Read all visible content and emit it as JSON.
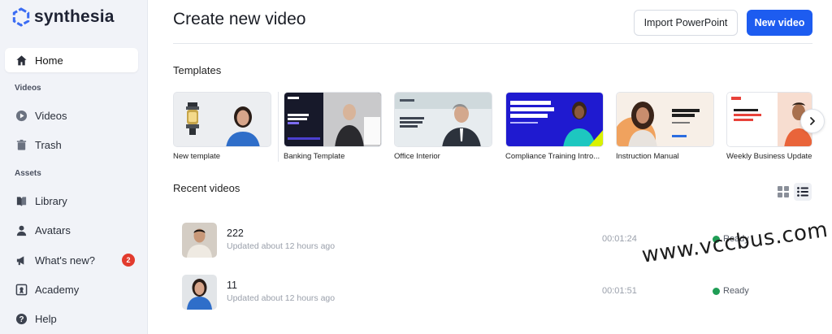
{
  "app": {
    "logo_text": "synthesia",
    "brand_color": "#1d5cf0"
  },
  "sidebar": {
    "items": [
      {
        "label": "Home",
        "icon": "home-icon",
        "active": true
      },
      {
        "section": "Videos"
      },
      {
        "label": "Videos",
        "icon": "play-circle-icon"
      },
      {
        "label": "Trash",
        "icon": "trash-icon"
      },
      {
        "section": "Assets"
      },
      {
        "label": "Library",
        "icon": "book-icon"
      },
      {
        "label": "Avatars",
        "icon": "person-icon"
      },
      {
        "label": "What's new?",
        "icon": "megaphone-icon",
        "badge": "2"
      },
      {
        "label": "Academy",
        "icon": "academy-icon"
      },
      {
        "label": "Help",
        "icon": "help-icon"
      }
    ],
    "home_label": "Home",
    "videos_section": "Videos",
    "videos_label": "Videos",
    "trash_label": "Trash",
    "assets_section": "Assets",
    "library_label": "Library",
    "avatars_label": "Avatars",
    "whatsnew_label": "What's new?",
    "whatsnew_badge": "2",
    "academy_label": "Academy",
    "help_label": "Help"
  },
  "header": {
    "title": "Create new video",
    "import_button": "Import PowerPoint",
    "new_button": "New video"
  },
  "templates": {
    "heading": "Templates",
    "items": [
      {
        "name": "New template"
      },
      {
        "name": "Banking Template"
      },
      {
        "name": "Office Interior"
      },
      {
        "name": "Compliance Training Intro..."
      },
      {
        "name": "Instruction Manual"
      },
      {
        "name": "Weekly Business Update"
      }
    ]
  },
  "recent": {
    "heading": "Recent videos",
    "videos": [
      {
        "name": "222",
        "updated": "Updated about 12 hours ago",
        "duration": "00:01:24",
        "status": "Ready"
      },
      {
        "name": "11",
        "updated": "Updated about 12 hours ago",
        "duration": "00:01:51",
        "status": "Ready"
      }
    ]
  },
  "watermark": "www.vccbus.com"
}
